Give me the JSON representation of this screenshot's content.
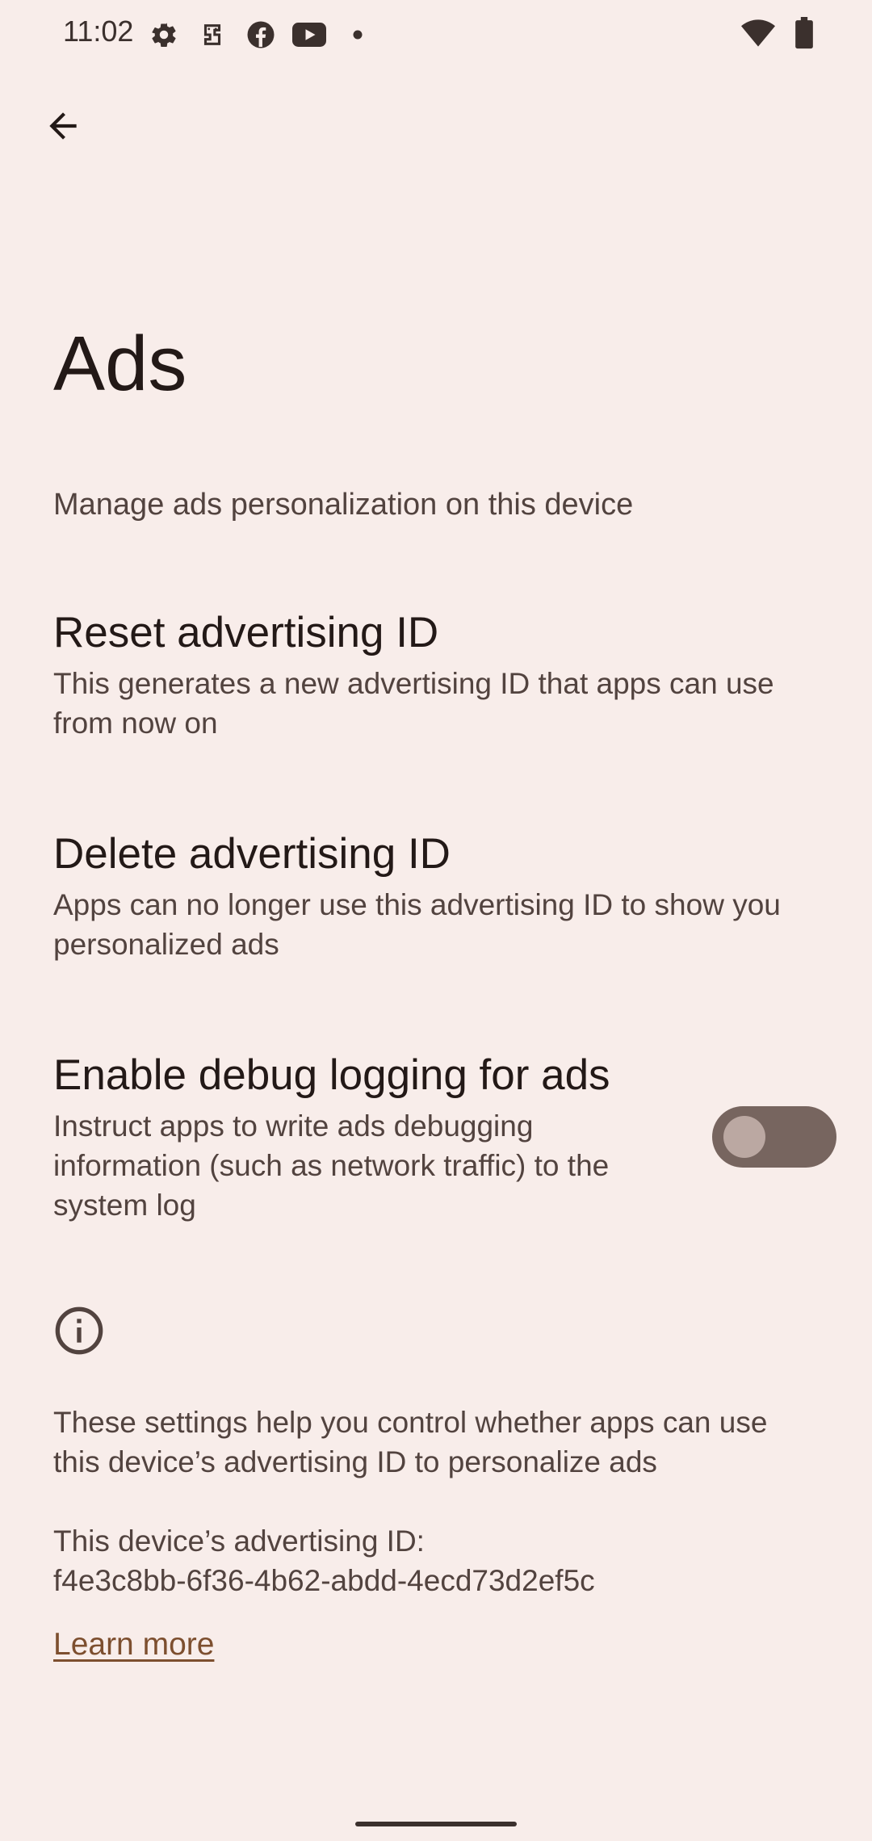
{
  "status_bar": {
    "time": "11:02",
    "icons_left": [
      "gear-icon",
      "assistant-face-icon",
      "facebook-icon",
      "youtube-icon",
      "notification-dot-icon"
    ],
    "icons_right": [
      "wifi-icon",
      "battery-icon"
    ]
  },
  "header": {
    "back_icon": "arrow-left-icon"
  },
  "page": {
    "title": "Ads",
    "subtitle": "Manage ads personalization on this device"
  },
  "preferences": [
    {
      "title": "Reset advertising ID",
      "summary_line1": "This generates a new advertising ID that apps can use",
      "summary_line2": "from now on"
    },
    {
      "title": "Delete advertising ID",
      "summary_line1": "Apps can no longer use this advertising ID to show you",
      "summary_line2": "personalized ads"
    },
    {
      "title": "Enable debug logging for ads",
      "summary_line1": "Instruct apps to write ads debugging",
      "summary_line2": "information (such as network traffic) to the",
      "summary_line3": "system log",
      "toggle_on": false
    }
  ],
  "footer": {
    "info_icon": "info-icon",
    "text_line1": "These settings help you control whether apps can use",
    "text_line2": "this device’s advertising ID to personalize ads",
    "id_label": "This device’s advertising ID:",
    "id_value": "f4e3c8bb-6f36-4b62-abdd-4ecd73d2ef5c",
    "learn_more": "Learn more"
  },
  "colors": {
    "background": "#f8edea",
    "text_primary": "#231917",
    "text_secondary": "#52433f",
    "toggle_track_off": "#77655f",
    "link": "#7d4f2f"
  }
}
